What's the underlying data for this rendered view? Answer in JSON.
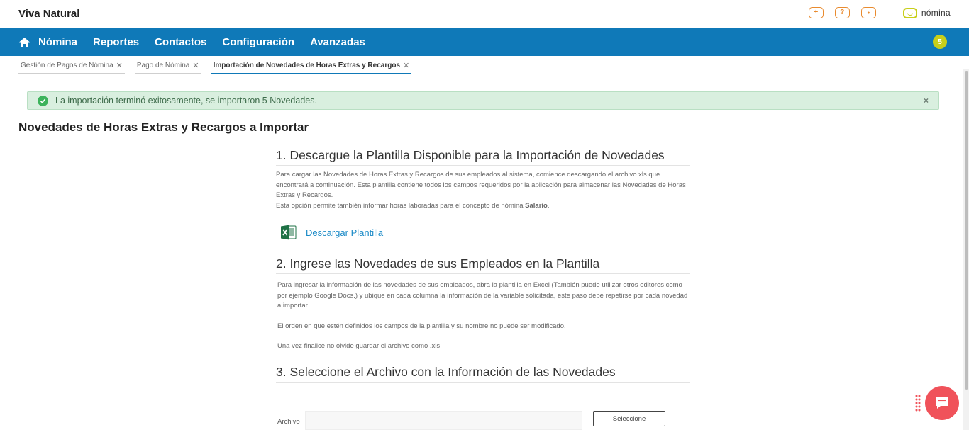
{
  "header": {
    "brand": "Viva Natural",
    "icons": [
      "plus-icon",
      "help-icon",
      "user-icon"
    ],
    "icon_glyphs": {
      "plus": "+",
      "help": "?",
      "user": "●"
    },
    "logo_text": "nómina"
  },
  "nav": {
    "items": [
      "Nómina",
      "Reportes",
      "Contactos",
      "Configuración",
      "Avanzadas"
    ],
    "notification_count": "5"
  },
  "tabs": [
    {
      "label": "Gestión de Pagos de Nómina",
      "active": false
    },
    {
      "label": "Pago de Nómina",
      "active": false
    },
    {
      "label": "Importación de Novedades de Horas Extras y Recargos",
      "active": true
    }
  ],
  "tab_close": "✕",
  "alert": {
    "text": "La importación terminó exitosamente, se importaron 5 Novedades.",
    "close": "×"
  },
  "page_title": "Novedades de Horas Extras y Recargos a Importar",
  "section1": {
    "title": "1. Descargue la Plantilla Disponible para la Importación de Novedades",
    "para1": "Para cargar las Novedades de Horas Extras y Recargos de sus empleados al sistema, comience descargando el archivo.xls que encontrará a continuación. Esta plantilla contiene todos los campos requeridos por la aplicación para almacenar las Novedades de Horas Extras y Recargos.",
    "para2_prefix": "Esta opción permite también informar horas laboradas para el concepto de nómina ",
    "para2_bold": "Salario",
    "para2_suffix": ".",
    "download_label": "Descargar Plantilla"
  },
  "section2": {
    "title": "2. Ingrese las Novedades de sus Empleados en la Plantilla",
    "para1": "Para ingresar la información de las novedades de sus empleados, abra la plantilla en Excel (También puede utilizar otros editores como por ejemplo Google Docs.) y ubique en cada columna la información de la variable solicitada, este paso debe repetirse por cada novedad a importar.",
    "para2": "El orden en que estén definidos los campos de la plantilla y su nombre no puede ser modificado.",
    "para3": "Una vez finalice no olvide guardar el archivo como .xls"
  },
  "section3": {
    "title": "3. Seleccione el Archivo con la Información de las Novedades",
    "file_label": "Archivo",
    "file_value": "",
    "button_label": "Seleccione"
  },
  "colors": {
    "nav_bg": "#0f79b8",
    "accent_orange": "#e98b2f",
    "logo_green": "#c8cf1a",
    "success_bg": "#d9efdf",
    "link": "#1a8ac7",
    "chat": "#f0525a"
  }
}
